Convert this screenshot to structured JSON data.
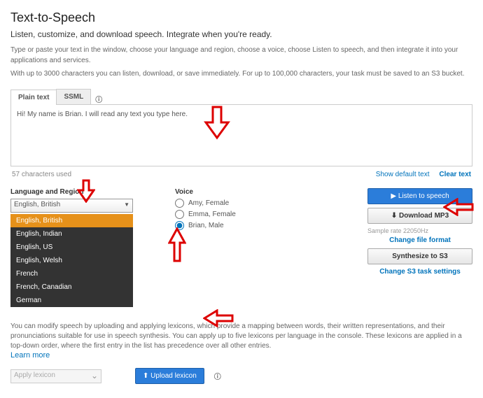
{
  "header": {
    "title": "Text-to-Speech",
    "subtitle": "Listen, customize, and download speech. Integrate when you're ready.",
    "desc1": "Type or paste your text in the window, choose your language and region, choose a voice, choose Listen to speech, and then integrate it into your applications and services.",
    "desc2": "With up to 3000 characters you can listen, download, or save immediately. For up to 100,000 characters, your task must be saved to an S3 bucket."
  },
  "tabs": {
    "plain": "Plain text",
    "ssml": "SSML"
  },
  "editor": {
    "text": "Hi! My name is Brian. I will read any text you type here.",
    "char_count": "57 characters used",
    "show_default": "Show default text",
    "clear": "Clear text"
  },
  "lang": {
    "label": "Language and Region",
    "selected": "English, British",
    "options": [
      "English, British",
      "English, Indian",
      "English, US",
      "English, Welsh",
      "French",
      "French, Canadian",
      "German"
    ]
  },
  "voice": {
    "label": "Voice",
    "options": [
      "Amy, Female",
      "Emma, Female",
      "Brian, Male"
    ],
    "selected_index": 2
  },
  "actions": {
    "listen": "Listen to speech",
    "download": "Download MP3",
    "sample_rate": "Sample rate 22050Hz",
    "change_format": "Change file format",
    "synthesize": "Synthesize to S3",
    "change_s3": "Change S3 task settings"
  },
  "lexicon": {
    "blurb": "You can modify speech by uploading and applying lexicons, which provide a mapping between words, their written representations, and their pronunciations suitable for use in speech synthesis. You can apply up to five lexicons per language in the console. These lexicons are applied in a top-down order, where the first entry in the list has precedence over all other entries.",
    "learn_more": "Learn more",
    "apply_placeholder": "Apply lexicon",
    "upload": "Upload lexicon"
  },
  "icons": {
    "play": "▶",
    "download": "⬇",
    "upload": "⬆"
  }
}
